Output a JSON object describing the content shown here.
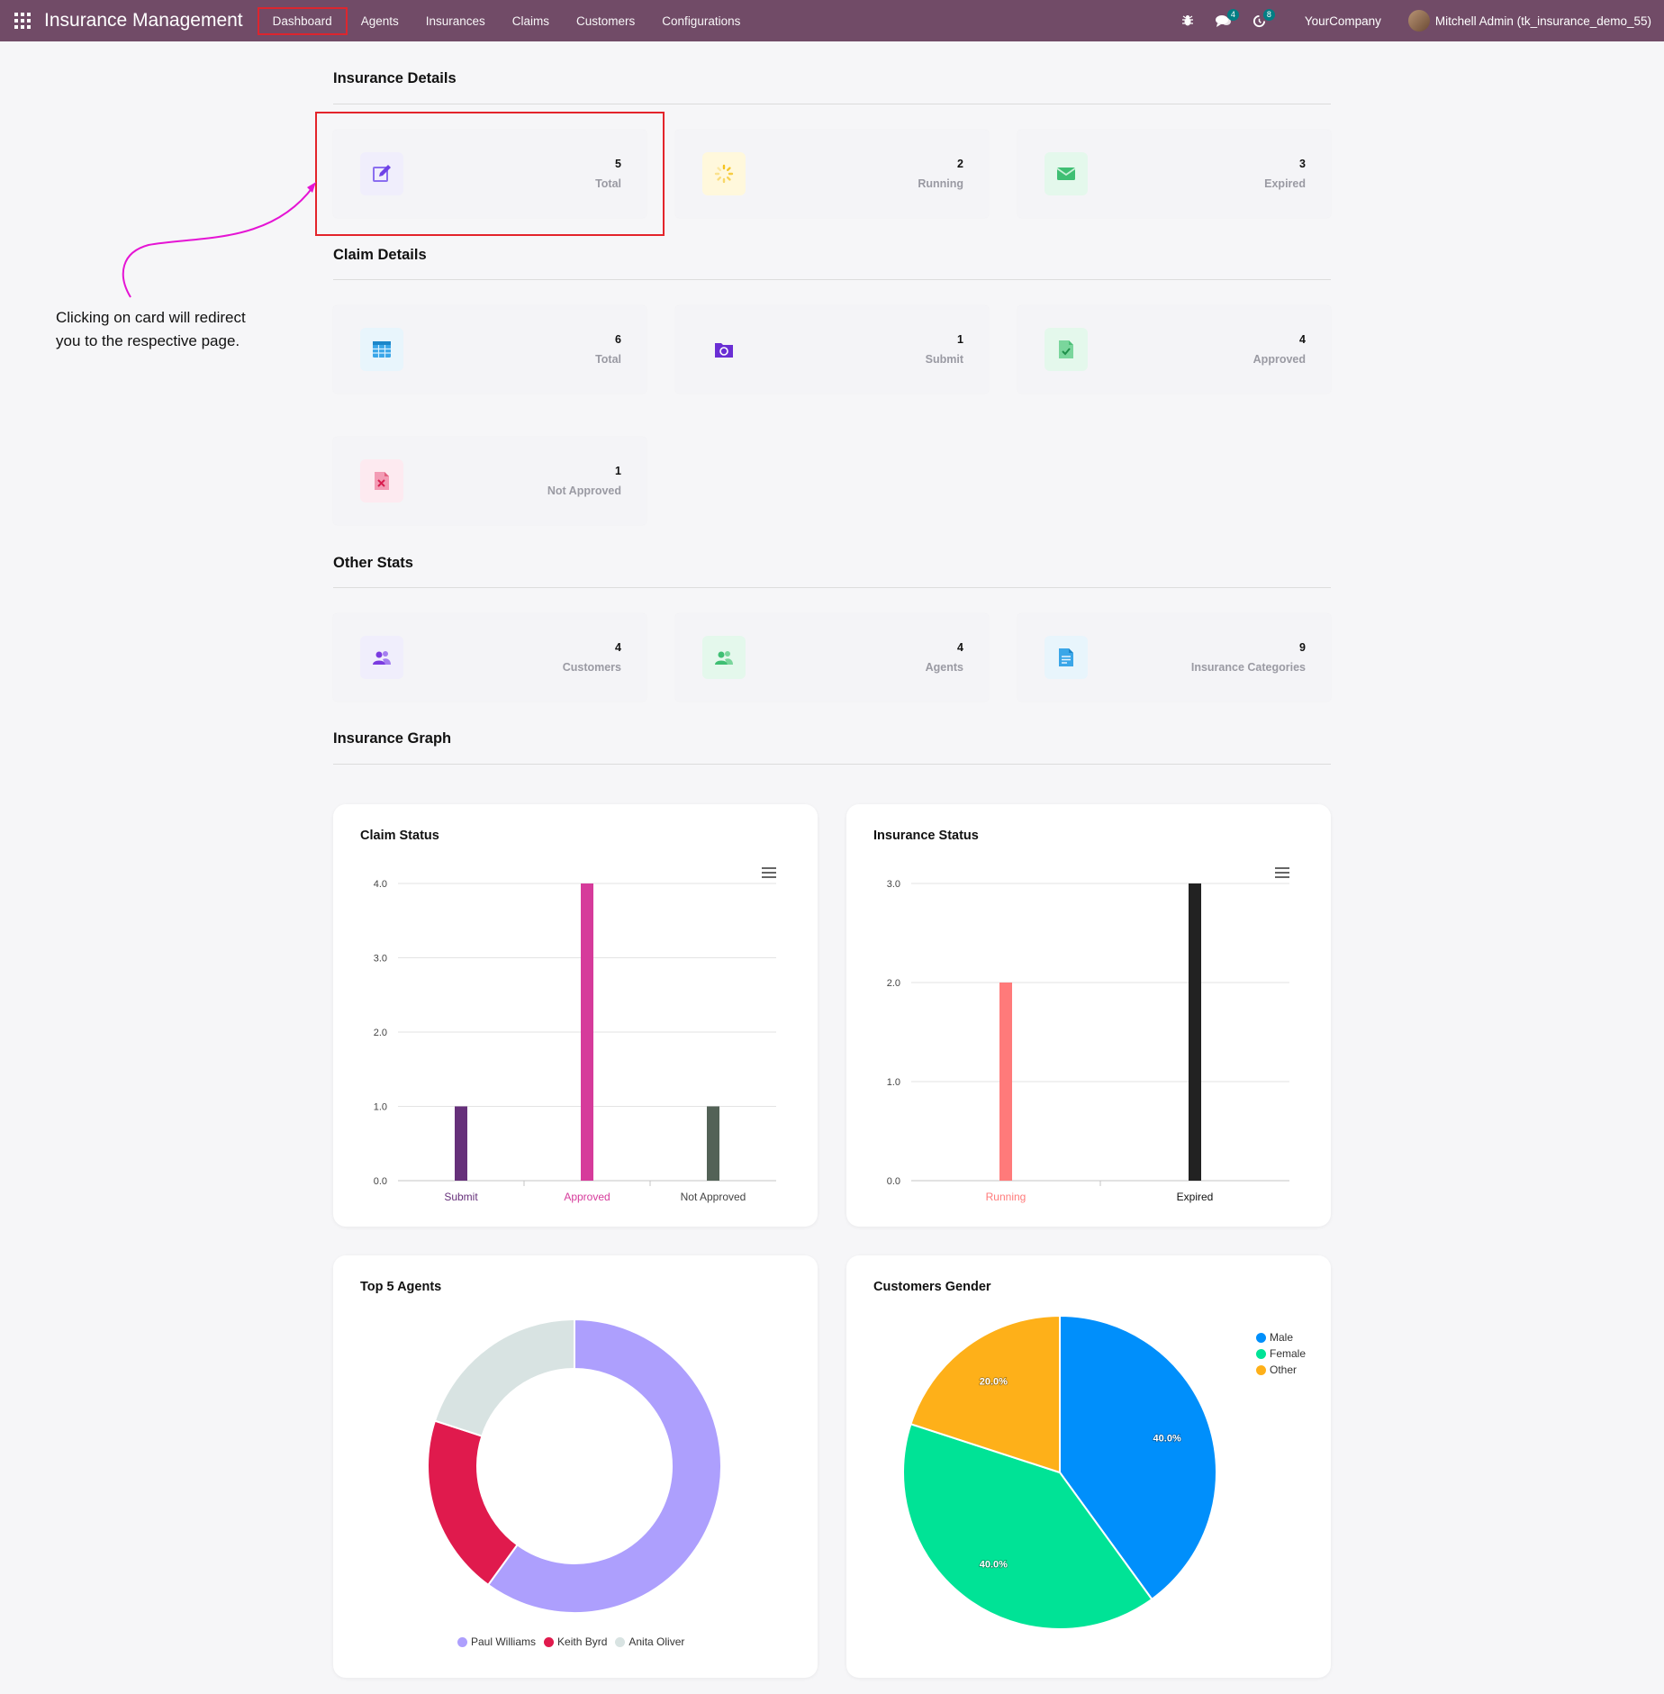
{
  "navbar": {
    "brand": "Insurance Management",
    "menu": [
      "Dashboard",
      "Agents",
      "Insurances",
      "Claims",
      "Customers",
      "Configurations"
    ],
    "active_index": 0,
    "chat_badge": "4",
    "activity_badge": "8",
    "company": "YourCompany",
    "user": "Mitchell Admin (tk_insurance_demo_55)"
  },
  "sections": {
    "insurance_details": "Insurance Details",
    "claim_details": "Claim Details",
    "other_stats": "Other Stats",
    "insurance_graph": "Insurance Graph"
  },
  "insurance_cards": [
    {
      "value": "5",
      "label": "Total",
      "icon": "edit-icon"
    },
    {
      "value": "2",
      "label": "Running",
      "icon": "spinner-icon"
    },
    {
      "value": "3",
      "label": "Expired",
      "icon": "envelope-icon"
    }
  ],
  "claim_cards": [
    {
      "value": "6",
      "label": "Total",
      "icon": "table-icon"
    },
    {
      "value": "1",
      "label": "Submit",
      "icon": "folder-sync-icon"
    },
    {
      "value": "4",
      "label": "Approved",
      "icon": "file-check-icon"
    },
    {
      "value": "1",
      "label": "Not Approved",
      "icon": "file-x-icon"
    }
  ],
  "other_cards": [
    {
      "value": "4",
      "label": "Customers",
      "icon": "users-icon"
    },
    {
      "value": "4",
      "label": "Agents",
      "icon": "agents-icon"
    },
    {
      "value": "9",
      "label": "Insurance Categories",
      "icon": "document-icon"
    }
  ],
  "annotation": "Clicking on card will redirect you to the respective page.",
  "colors": {
    "navbar": "#714b67",
    "highlight": "#e3242b",
    "arrow": "#e514d4"
  },
  "chart_data": [
    {
      "type": "bar",
      "title": "Claim Status",
      "categories": [
        "Submit",
        "Approved",
        "Not Approved"
      ],
      "values": [
        1,
        4,
        1
      ],
      "colors": [
        "#66307a",
        "#d63b9b",
        "#536257"
      ],
      "ylim": [
        0,
        4
      ],
      "yticks": [
        "0.0",
        "1.0",
        "2.0",
        "3.0",
        "4.0"
      ],
      "grid": true
    },
    {
      "type": "bar",
      "title": "Insurance Status",
      "categories": [
        "Running",
        "Expired"
      ],
      "values": [
        2,
        3
      ],
      "colors": [
        "#ff7a7a",
        "#222222"
      ],
      "ylim": [
        0,
        3
      ],
      "yticks": [
        "0.0",
        "1.0",
        "2.0",
        "3.0"
      ],
      "grid": true
    },
    {
      "type": "pie",
      "title": "Top 5 Agents",
      "donut": true,
      "labels": [
        "Paul Williams",
        "Keith Byrd",
        "Anita Oliver"
      ],
      "values": [
        3,
        1,
        1
      ],
      "colors": [
        "#ad9ffd",
        "#e01a4d",
        "#d8e3e2"
      ],
      "legend": "bottom"
    },
    {
      "type": "pie",
      "title": "Customers Gender",
      "donut": false,
      "labels": [
        "Male",
        "Female",
        "Other"
      ],
      "values": [
        40,
        40,
        20
      ],
      "data_labels": [
        "40.0%",
        "40.0%",
        "20.0%"
      ],
      "colors": [
        "#008ffb",
        "#00e396",
        "#feb019"
      ],
      "legend": "top-right"
    }
  ]
}
